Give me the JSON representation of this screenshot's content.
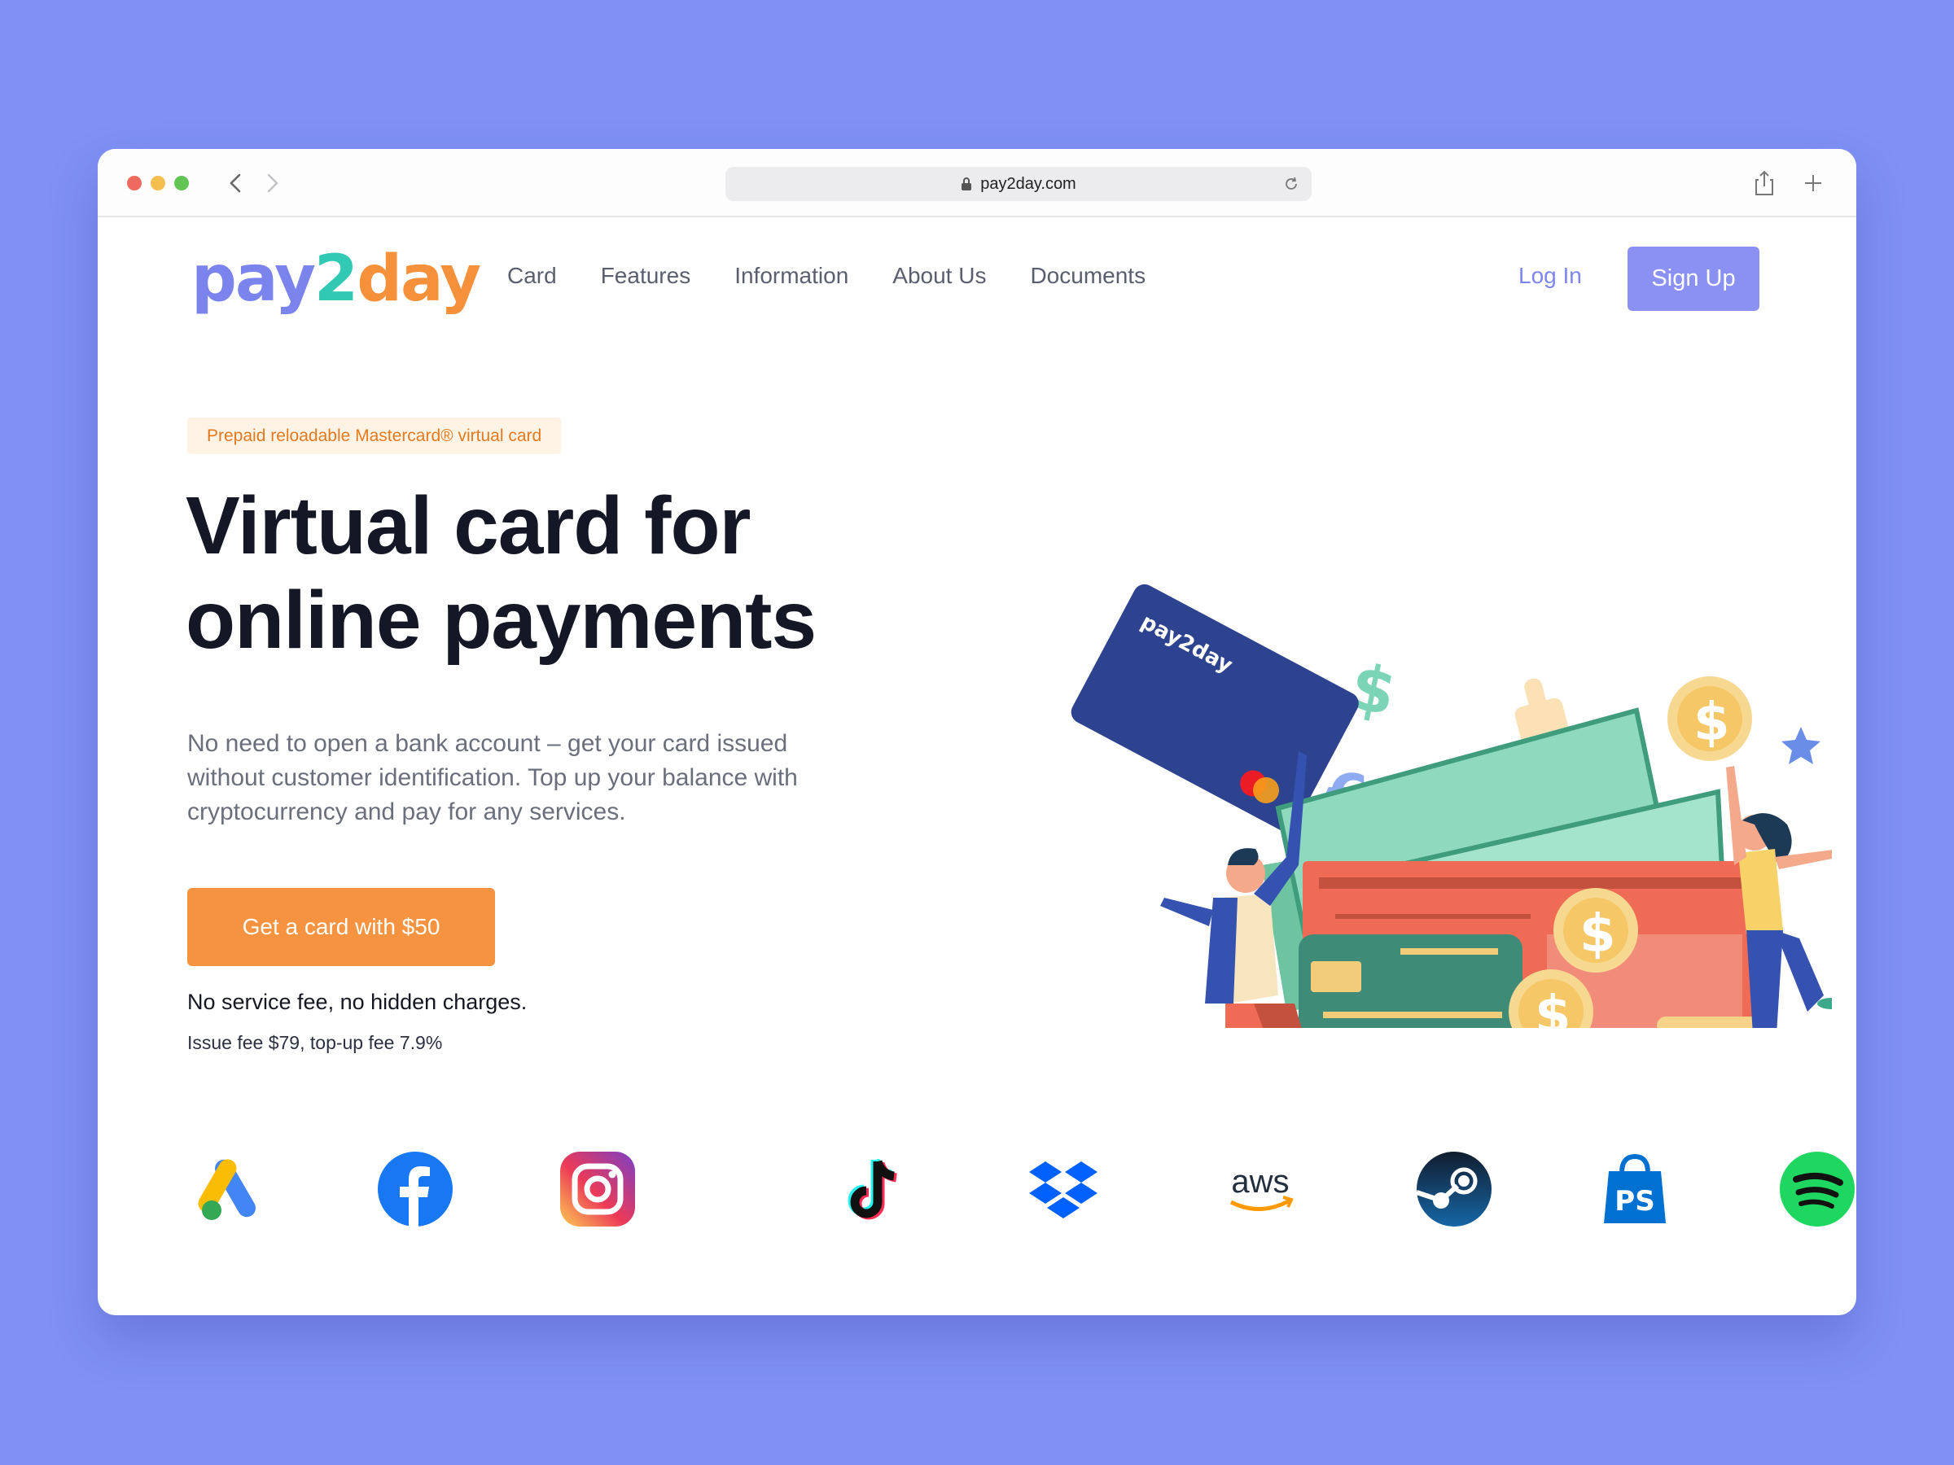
{
  "browser": {
    "url": "pay2day.com"
  },
  "nav": {
    "logo_part1": "pay",
    "logo_part2": "2",
    "logo_part3": "day",
    "items": [
      {
        "label": "Card"
      },
      {
        "label": "Features"
      },
      {
        "label": "Information"
      },
      {
        "label": "About Us"
      },
      {
        "label": "Documents"
      }
    ],
    "login_label": "Log In",
    "signup_label": "Sign Up"
  },
  "hero": {
    "badge": "Prepaid reloadable Mastercard® virtual card",
    "headline_line1": "Virtual card for",
    "headline_line2": "online payments",
    "subtext": "No need to open a bank account – get your card issued without customer identification. Top up your balance with cryptocurrency and pay for any services.",
    "cta_label": "Get a card with $50",
    "no_fee": "No service fee, no hidden charges.",
    "fees": "Issue fee $79, top-up fee 7.9%"
  },
  "illustration": {
    "card_brand": "pay2day"
  },
  "brands": [
    {
      "icon": "google-ads-icon"
    },
    {
      "icon": "facebook-icon"
    },
    {
      "icon": "instagram-icon"
    },
    {
      "icon": "tiktok-icon"
    },
    {
      "icon": "dropbox-icon"
    },
    {
      "icon": "aws-icon",
      "text": "aws"
    },
    {
      "icon": "steam-icon"
    },
    {
      "icon": "playstation-store-icon"
    },
    {
      "icon": "spotify-icon"
    }
  ],
  "colors": {
    "background": "#8090f4",
    "accent_purple": "#8a91f2",
    "accent_orange": "#f59340",
    "logo_teal": "#32c9b4"
  }
}
